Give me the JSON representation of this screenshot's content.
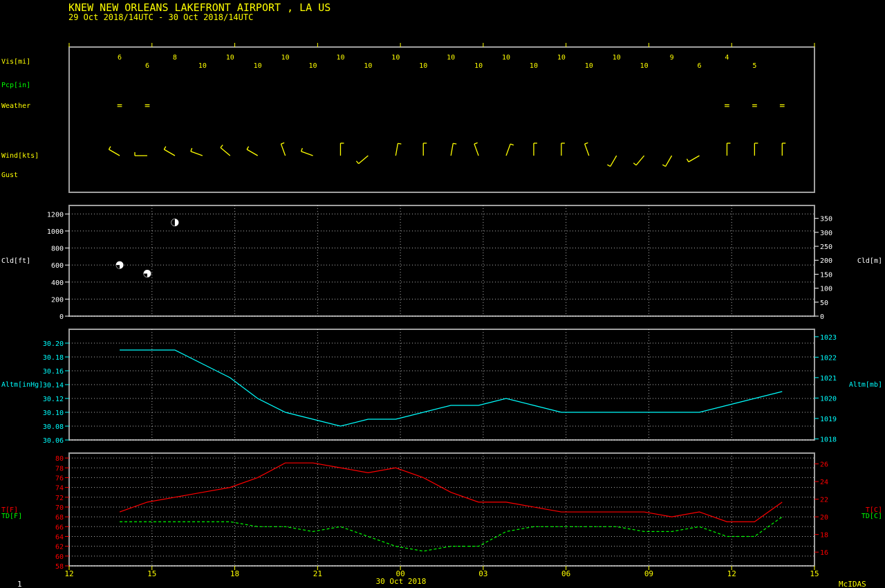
{
  "header": {
    "station": "KNEW  NEW ORLEANS LAKEFRONT AIRPORT , LA US",
    "period": "29 Oct 2018/14UTC - 30 Oct 2018/14UTC"
  },
  "footer": {
    "left_number": "1",
    "date": "30 Oct 2018",
    "brand": "McIDAS"
  },
  "colors": {
    "yellow": "#ffff00",
    "green": "#00ff00",
    "cyan": "#00ffff",
    "red": "#ff0000",
    "white": "#ffffff",
    "frame": "#a0a0a0",
    "grid": "#ffffff"
  },
  "chart_data": [
    {
      "type": "table",
      "panel": "observations",
      "row_labels": [
        "Vis[mi]",
        "Pcp[in]",
        "Weather",
        "Wind[kts]",
        "Gust"
      ],
      "x_hours": [
        13.83,
        14.83,
        15.83,
        16.83,
        17.83,
        18.83,
        19.83,
        20.83,
        21.83,
        22.83,
        23.83,
        24.83,
        25.83,
        26.83,
        27.83,
        28.83,
        29.83,
        30.83,
        31.83,
        32.83,
        33.83,
        34.83,
        35.83,
        36.83,
        37.83
      ],
      "visibility": [
        "6",
        "6",
        "8",
        "10",
        "10",
        "10",
        "10",
        "10",
        "10",
        "10",
        "10",
        "10",
        "10",
        "10",
        "10",
        "10",
        "10",
        "10",
        "10",
        "10",
        "9",
        "6",
        "4",
        "5"
      ],
      "weather_symbol": "=",
      "weather_hours": [
        13.83,
        14.83,
        35.83,
        36.83,
        37.83
      ],
      "wind_barb_directions": [
        300,
        270,
        300,
        290,
        310,
        300,
        340,
        290,
        360,
        230,
        10,
        360,
        10,
        340,
        20,
        360,
        360,
        340,
        210,
        220,
        210,
        240,
        360,
        360,
        360
      ]
    },
    {
      "type": "scatter",
      "panel": "cloud",
      "xlim": [
        12,
        39
      ],
      "ylabel": "Cld[ft]",
      "ylabel_right": "Cld[m]",
      "ylim": [
        0,
        1300
      ],
      "yticks": [
        0,
        200,
        400,
        600,
        800,
        1000,
        1200
      ],
      "yticks_right_m": [
        0,
        50,
        100,
        150,
        200,
        250,
        300,
        350
      ],
      "points": [
        {
          "x": 13.83,
          "y": 600,
          "cover": "broken"
        },
        {
          "x": 14.83,
          "y": 500,
          "cover": "broken"
        },
        {
          "x": 15.83,
          "y": 1100,
          "cover": "scattered"
        }
      ]
    },
    {
      "type": "line",
      "panel": "altimeter",
      "xlim": [
        12,
        39
      ],
      "ylabel": "Altm[inHg]",
      "ylabel_right": "Altm[mb]",
      "ylim": [
        30.06,
        30.22
      ],
      "yticks": [
        30.06,
        30.08,
        30.1,
        30.12,
        30.14,
        30.16,
        30.18,
        30.2
      ],
      "yticks_right_mb": [
        1018,
        1019,
        1020,
        1021,
        1022,
        1023
      ],
      "x": [
        13.83,
        14.83,
        15.83,
        16.83,
        17.83,
        18.83,
        19.83,
        20.83,
        21.83,
        22.83,
        23.83,
        24.83,
        25.83,
        26.83,
        27.83,
        28.83,
        29.83,
        30.83,
        31.83,
        32.83,
        33.83,
        34.83,
        35.83,
        36.83,
        37.83
      ],
      "values": [
        30.19,
        30.19,
        30.19,
        30.17,
        30.15,
        30.12,
        30.1,
        30.09,
        30.08,
        30.09,
        30.09,
        30.1,
        30.11,
        30.11,
        30.12,
        30.11,
        30.1,
        30.1,
        30.1,
        30.1,
        30.1,
        30.1,
        30.11,
        30.12,
        30.13
      ]
    },
    {
      "type": "line",
      "panel": "temperature",
      "xlim": [
        12,
        39
      ],
      "ylabel": "T[F]",
      "ylabel2": "TD[F]",
      "ylabel_right": "T[C]",
      "ylabel_right2": "TD[C]",
      "ylim": [
        58,
        81
      ],
      "yticks": [
        58,
        60,
        62,
        64,
        66,
        68,
        70,
        72,
        74,
        76,
        78,
        80
      ],
      "yticks_right_c": [
        16,
        18,
        20,
        22,
        24,
        26
      ],
      "x": [
        13.83,
        14.83,
        15.83,
        16.83,
        17.83,
        18.83,
        19.83,
        20.83,
        21.83,
        22.83,
        23.83,
        24.83,
        25.83,
        26.83,
        27.83,
        28.83,
        29.83,
        30.83,
        31.83,
        32.83,
        33.83,
        34.83,
        35.83,
        36.83,
        37.83
      ],
      "series": [
        {
          "name": "T[F]",
          "color": "#ff0000",
          "dashed": false,
          "values": [
            69,
            71,
            72,
            73,
            74,
            76,
            79,
            79,
            78,
            77,
            78,
            76,
            73,
            71,
            71,
            70,
            69,
            69,
            69,
            69,
            68,
            69,
            67,
            67,
            71
          ]
        },
        {
          "name": "TD[F]",
          "color": "#00ff00",
          "dashed": true,
          "values": [
            67,
            67,
            67,
            67,
            67,
            66,
            66,
            65,
            66,
            64,
            62,
            61,
            62,
            62,
            65,
            66,
            66,
            66,
            66,
            65,
            65,
            66,
            64,
            64,
            68
          ]
        }
      ],
      "xticks": [
        12,
        15,
        18,
        21,
        24,
        27,
        30,
        33,
        36,
        39
      ],
      "xtick_labels": [
        "12",
        "15",
        "18",
        "21",
        "00",
        "03",
        "06",
        "09",
        "12",
        "15"
      ]
    }
  ]
}
